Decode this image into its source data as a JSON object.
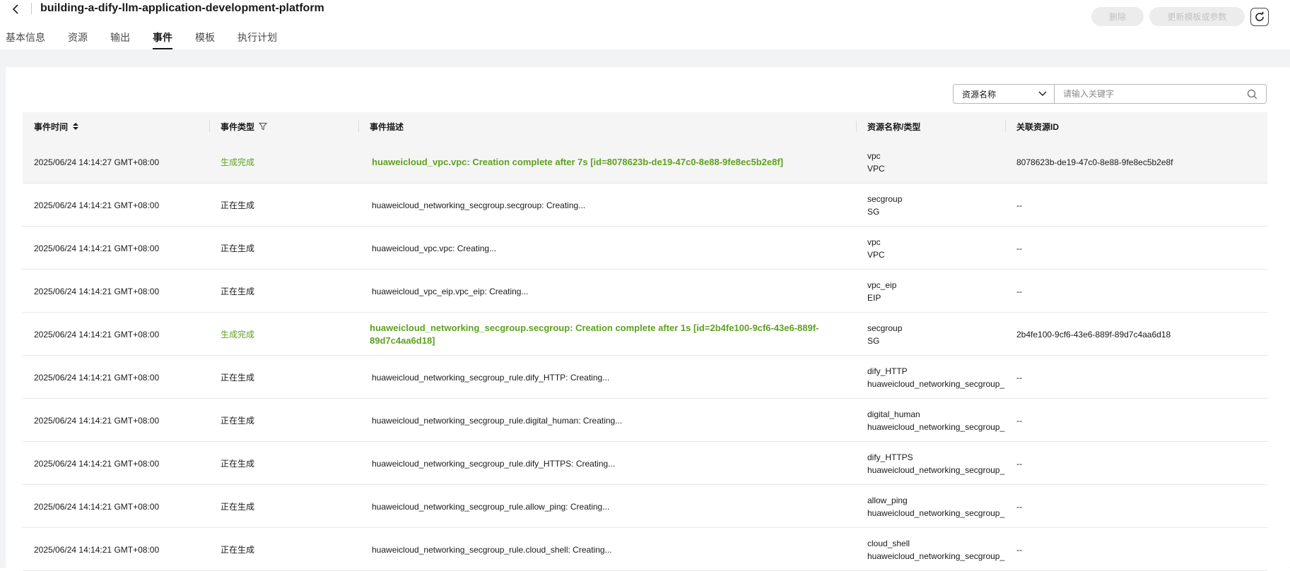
{
  "header": {
    "title": "building-a-dify-llm-application-development-platform",
    "delete_label": "删除",
    "update_label": "更新模板或参数"
  },
  "tabs": [
    {
      "label": "基本信息"
    },
    {
      "label": "资源"
    },
    {
      "label": "输出"
    },
    {
      "label": "事件",
      "active": true
    },
    {
      "label": "模板"
    },
    {
      "label": "执行计划"
    }
  ],
  "search": {
    "select_value": "资源名称",
    "placeholder": "请输入关键字"
  },
  "table": {
    "columns": [
      "事件时间",
      "事件类型",
      "事件描述",
      "资源名称/类型",
      "关联资源ID"
    ],
    "rows": [
      {
        "time": "2025/06/24 14:14:27 GMT+08:00",
        "type": "生成完成",
        "done": true,
        "desc": "huaweicloud_vpc.vpc: Creation complete after 7s [id=8078623b-de19-47c0-8e88-9fe8ec5b2e8f]",
        "res_name": "vpc",
        "res_type": "VPC",
        "res_id": "8078623b-de19-47c0-8e88-9fe8ec5b2e8f"
      },
      {
        "time": "2025/06/24 14:14:21 GMT+08:00",
        "type": "正在生成",
        "done": false,
        "desc": "huaweicloud_networking_secgroup.secgroup: Creating...",
        "res_name": "secgroup",
        "res_type": "SG",
        "res_id": "--"
      },
      {
        "time": "2025/06/24 14:14:21 GMT+08:00",
        "type": "正在生成",
        "done": false,
        "desc": "huaweicloud_vpc.vpc: Creating...",
        "res_name": "vpc",
        "res_type": "VPC",
        "res_id": "--"
      },
      {
        "time": "2025/06/24 14:14:21 GMT+08:00",
        "type": "正在生成",
        "done": false,
        "desc": "huaweicloud_vpc_eip.vpc_eip: Creating...",
        "res_name": "vpc_eip",
        "res_type": "EIP",
        "res_id": "--"
      },
      {
        "time": "2025/06/24 14:14:21 GMT+08:00",
        "type": "生成完成",
        "done": true,
        "desc": "huaweicloud_networking_secgroup.secgroup: Creation complete after 1s [id=2b4fe100-9cf6-43e6-889f-89d7c4aa6d18]",
        "res_name": "secgroup",
        "res_type": "SG",
        "res_id": "2b4fe100-9cf6-43e6-889f-89d7c4aa6d18"
      },
      {
        "time": "2025/06/24 14:14:21 GMT+08:00",
        "type": "正在生成",
        "done": false,
        "desc": "huaweicloud_networking_secgroup_rule.dify_HTTP: Creating...",
        "res_name": "dify_HTTP",
        "res_type": "huaweicloud_networking_secgroup_",
        "res_id": "--"
      },
      {
        "time": "2025/06/24 14:14:21 GMT+08:00",
        "type": "正在生成",
        "done": false,
        "desc": "huaweicloud_networking_secgroup_rule.digital_human: Creating...",
        "res_name": "digital_human",
        "res_type": "huaweicloud_networking_secgroup_",
        "res_id": "--"
      },
      {
        "time": "2025/06/24 14:14:21 GMT+08:00",
        "type": "正在生成",
        "done": false,
        "desc": "huaweicloud_networking_secgroup_rule.dify_HTTPS: Creating...",
        "res_name": "dify_HTTPS",
        "res_type": "huaweicloud_networking_secgroup_",
        "res_id": "--"
      },
      {
        "time": "2025/06/24 14:14:21 GMT+08:00",
        "type": "正在生成",
        "done": false,
        "desc": "huaweicloud_networking_secgroup_rule.allow_ping: Creating...",
        "res_name": "allow_ping",
        "res_type": "huaweicloud_networking_secgroup_",
        "res_id": "--"
      },
      {
        "time": "2025/06/24 14:14:21 GMT+08:00",
        "type": "正在生成",
        "done": false,
        "desc": "huaweicloud_networking_secgroup_rule.cloud_shell: Creating...",
        "res_name": "cloud_shell",
        "res_type": "huaweicloud_networking_secgroup_",
        "res_id": "--"
      }
    ]
  },
  "icons": {
    "back": "chevron-left-icon",
    "refresh": "refresh-icon",
    "sort": "sort-icon",
    "filter": "filter-icon",
    "dropdown": "chevron-down-icon",
    "search": "search-icon"
  },
  "colors": {
    "success_text": "#5ea11f",
    "page_background": "#f1f3f5",
    "header_row": "#f5f5f6"
  }
}
